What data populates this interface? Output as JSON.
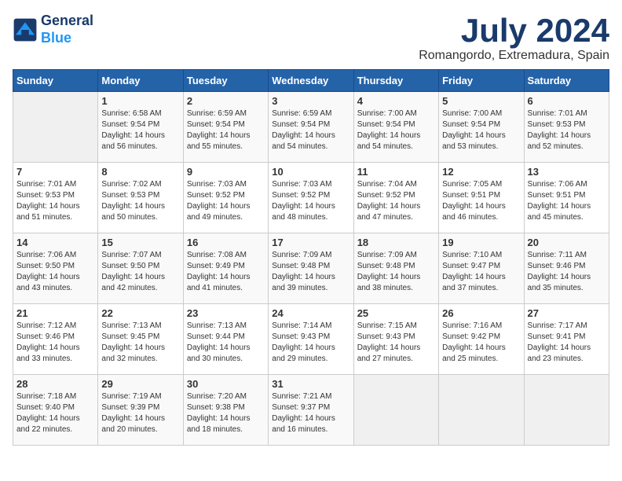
{
  "header": {
    "logo_line1": "General",
    "logo_line2": "Blue",
    "month": "July 2024",
    "location": "Romangordo, Extremadura, Spain"
  },
  "days_of_week": [
    "Sunday",
    "Monday",
    "Tuesday",
    "Wednesday",
    "Thursday",
    "Friday",
    "Saturday"
  ],
  "weeks": [
    [
      {
        "day": "",
        "info": ""
      },
      {
        "day": "1",
        "info": "Sunrise: 6:58 AM\nSunset: 9:54 PM\nDaylight: 14 hours\nand 56 minutes."
      },
      {
        "day": "2",
        "info": "Sunrise: 6:59 AM\nSunset: 9:54 PM\nDaylight: 14 hours\nand 55 minutes."
      },
      {
        "day": "3",
        "info": "Sunrise: 6:59 AM\nSunset: 9:54 PM\nDaylight: 14 hours\nand 54 minutes."
      },
      {
        "day": "4",
        "info": "Sunrise: 7:00 AM\nSunset: 9:54 PM\nDaylight: 14 hours\nand 54 minutes."
      },
      {
        "day": "5",
        "info": "Sunrise: 7:00 AM\nSunset: 9:54 PM\nDaylight: 14 hours\nand 53 minutes."
      },
      {
        "day": "6",
        "info": "Sunrise: 7:01 AM\nSunset: 9:53 PM\nDaylight: 14 hours\nand 52 minutes."
      }
    ],
    [
      {
        "day": "7",
        "info": "Sunrise: 7:01 AM\nSunset: 9:53 PM\nDaylight: 14 hours\nand 51 minutes."
      },
      {
        "day": "8",
        "info": "Sunrise: 7:02 AM\nSunset: 9:53 PM\nDaylight: 14 hours\nand 50 minutes."
      },
      {
        "day": "9",
        "info": "Sunrise: 7:03 AM\nSunset: 9:52 PM\nDaylight: 14 hours\nand 49 minutes."
      },
      {
        "day": "10",
        "info": "Sunrise: 7:03 AM\nSunset: 9:52 PM\nDaylight: 14 hours\nand 48 minutes."
      },
      {
        "day": "11",
        "info": "Sunrise: 7:04 AM\nSunset: 9:52 PM\nDaylight: 14 hours\nand 47 minutes."
      },
      {
        "day": "12",
        "info": "Sunrise: 7:05 AM\nSunset: 9:51 PM\nDaylight: 14 hours\nand 46 minutes."
      },
      {
        "day": "13",
        "info": "Sunrise: 7:06 AM\nSunset: 9:51 PM\nDaylight: 14 hours\nand 45 minutes."
      }
    ],
    [
      {
        "day": "14",
        "info": "Sunrise: 7:06 AM\nSunset: 9:50 PM\nDaylight: 14 hours\nand 43 minutes."
      },
      {
        "day": "15",
        "info": "Sunrise: 7:07 AM\nSunset: 9:50 PM\nDaylight: 14 hours\nand 42 minutes."
      },
      {
        "day": "16",
        "info": "Sunrise: 7:08 AM\nSunset: 9:49 PM\nDaylight: 14 hours\nand 41 minutes."
      },
      {
        "day": "17",
        "info": "Sunrise: 7:09 AM\nSunset: 9:48 PM\nDaylight: 14 hours\nand 39 minutes."
      },
      {
        "day": "18",
        "info": "Sunrise: 7:09 AM\nSunset: 9:48 PM\nDaylight: 14 hours\nand 38 minutes."
      },
      {
        "day": "19",
        "info": "Sunrise: 7:10 AM\nSunset: 9:47 PM\nDaylight: 14 hours\nand 37 minutes."
      },
      {
        "day": "20",
        "info": "Sunrise: 7:11 AM\nSunset: 9:46 PM\nDaylight: 14 hours\nand 35 minutes."
      }
    ],
    [
      {
        "day": "21",
        "info": "Sunrise: 7:12 AM\nSunset: 9:46 PM\nDaylight: 14 hours\nand 33 minutes."
      },
      {
        "day": "22",
        "info": "Sunrise: 7:13 AM\nSunset: 9:45 PM\nDaylight: 14 hours\nand 32 minutes."
      },
      {
        "day": "23",
        "info": "Sunrise: 7:13 AM\nSunset: 9:44 PM\nDaylight: 14 hours\nand 30 minutes."
      },
      {
        "day": "24",
        "info": "Sunrise: 7:14 AM\nSunset: 9:43 PM\nDaylight: 14 hours\nand 29 minutes."
      },
      {
        "day": "25",
        "info": "Sunrise: 7:15 AM\nSunset: 9:43 PM\nDaylight: 14 hours\nand 27 minutes."
      },
      {
        "day": "26",
        "info": "Sunrise: 7:16 AM\nSunset: 9:42 PM\nDaylight: 14 hours\nand 25 minutes."
      },
      {
        "day": "27",
        "info": "Sunrise: 7:17 AM\nSunset: 9:41 PM\nDaylight: 14 hours\nand 23 minutes."
      }
    ],
    [
      {
        "day": "28",
        "info": "Sunrise: 7:18 AM\nSunset: 9:40 PM\nDaylight: 14 hours\nand 22 minutes."
      },
      {
        "day": "29",
        "info": "Sunrise: 7:19 AM\nSunset: 9:39 PM\nDaylight: 14 hours\nand 20 minutes."
      },
      {
        "day": "30",
        "info": "Sunrise: 7:20 AM\nSunset: 9:38 PM\nDaylight: 14 hours\nand 18 minutes."
      },
      {
        "day": "31",
        "info": "Sunrise: 7:21 AM\nSunset: 9:37 PM\nDaylight: 14 hours\nand 16 minutes."
      },
      {
        "day": "",
        "info": ""
      },
      {
        "day": "",
        "info": ""
      },
      {
        "day": "",
        "info": ""
      }
    ]
  ]
}
